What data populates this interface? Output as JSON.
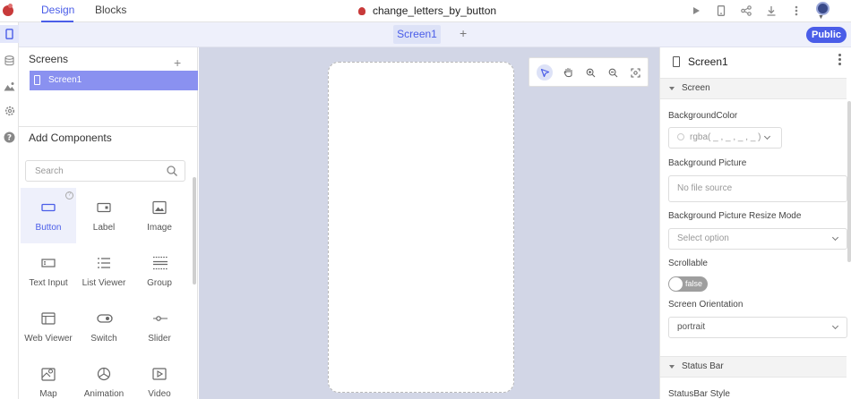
{
  "topbar": {
    "tabs": [
      {
        "label": "Design",
        "active": true
      },
      {
        "label": "Blocks",
        "active": false
      }
    ],
    "project_name": "change_letters_by_button",
    "actions": [
      "play-icon",
      "device-icon",
      "share-icon",
      "download-icon",
      "more-icon"
    ]
  },
  "tabs_bar": {
    "screen_tab": "Screen1",
    "add_label": "+",
    "public_label": "Public"
  },
  "rail": [
    "phone-icon",
    "database-icon",
    "media-icon",
    "settings-icon",
    "help-icon"
  ],
  "screens_panel": {
    "title": "Screens",
    "add_label": "+",
    "items": [
      "Screen1"
    ]
  },
  "components_panel": {
    "title": "Add Components",
    "search_placeholder": "Search",
    "items": [
      {
        "label": "Button",
        "icon": "button-icon",
        "active": true
      },
      {
        "label": "Label",
        "icon": "label-icon"
      },
      {
        "label": "Image",
        "icon": "image-icon"
      },
      {
        "label": "Text Input",
        "icon": "text-input-icon"
      },
      {
        "label": "List Viewer",
        "icon": "list-icon"
      },
      {
        "label": "Group",
        "icon": "group-icon"
      },
      {
        "label": "Web Viewer",
        "icon": "web-viewer-icon"
      },
      {
        "label": "Switch",
        "icon": "switch-icon"
      },
      {
        "label": "Slider",
        "icon": "slider-icon"
      },
      {
        "label": "Map",
        "icon": "map-icon"
      },
      {
        "label": "Animation",
        "icon": "animation-icon"
      },
      {
        "label": "Video",
        "icon": "video-icon"
      }
    ]
  },
  "canvas_tools": [
    "select-icon",
    "hand-icon",
    "zoom-in-icon",
    "zoom-out-icon",
    "fit-icon"
  ],
  "properties": {
    "title": "Screen1",
    "section_screen": "Screen",
    "background_color_label": "BackgroundColor",
    "background_color_value": "rgba( _ , _ , _ , _ )",
    "background_picture_label": "Background Picture",
    "background_picture_placeholder": "No file source",
    "resize_mode_label": "Background Picture Resize Mode",
    "resize_mode_placeholder": "Select option",
    "scrollable_label": "Scrollable",
    "scrollable_value": "false",
    "orientation_label": "Screen Orientation",
    "orientation_value": "portrait",
    "section_status_bar": "Status Bar",
    "statusbar_style_label": "StatusBar Style"
  }
}
